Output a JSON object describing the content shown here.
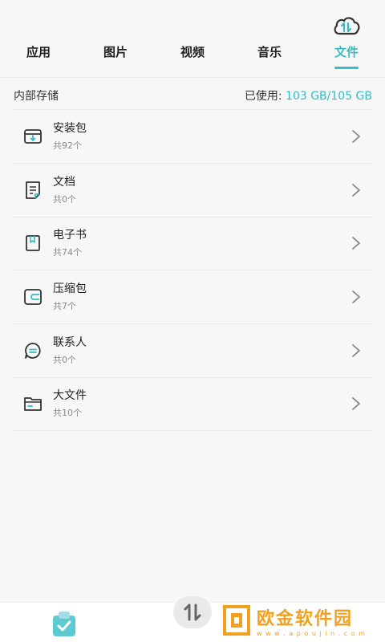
{
  "tabs": [
    {
      "label": "应用",
      "active": false
    },
    {
      "label": "图片",
      "active": false
    },
    {
      "label": "视频",
      "active": false
    },
    {
      "label": "音乐",
      "active": false
    },
    {
      "label": "文件",
      "active": true
    }
  ],
  "storage": {
    "label": "内部存储",
    "used_prefix": "已使用:",
    "used_value": "103 GB/105 GB"
  },
  "items": [
    {
      "title": "安装包",
      "count": "共92个",
      "icon": "archive-box-icon"
    },
    {
      "title": "文档",
      "count": "共0个",
      "icon": "document-icon"
    },
    {
      "title": "电子书",
      "count": "共74个",
      "icon": "ebook-icon"
    },
    {
      "title": "压缩包",
      "count": "共7个",
      "icon": "compressed-package-icon"
    },
    {
      "title": "联系人",
      "count": "共0个",
      "icon": "contact-chat-icon"
    },
    {
      "title": "大文件",
      "count": "共10个",
      "icon": "folder-icon"
    }
  ],
  "watermark": {
    "main": "欧金软件园",
    "sub": "w w w . a p o u j i n . c o m"
  },
  "colors": {
    "accent": "#35bcc6",
    "watermark": "#f2a01e"
  }
}
